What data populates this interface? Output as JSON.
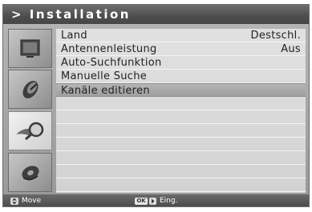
{
  "title": "> Installation",
  "menu": [
    {
      "label": "Land",
      "value": "Destschl.",
      "selected": false
    },
    {
      "label": "Antennenleistung",
      "value": "Aus",
      "selected": false
    },
    {
      "label": "Auto-Suchfunktion",
      "value": "",
      "selected": false
    },
    {
      "label": "Manuelle Suche",
      "value": "",
      "selected": false
    },
    {
      "label": "Kanäle editieren",
      "value": "",
      "selected": true
    }
  ],
  "side_icons": [
    {
      "name": "tv-screen-icon",
      "active": false
    },
    {
      "name": "satellite-dish-icon",
      "active": false
    },
    {
      "name": "search-magnifier-icon",
      "active": true
    },
    {
      "name": "disc-icon",
      "active": false
    }
  ],
  "footer": {
    "move_icon": "up-down-icon",
    "move_label": "Move",
    "ok_key": "OK",
    "ok_arrow_icon": "right-arrow-icon",
    "ok_label": "Eing."
  },
  "colors": {
    "title_bar": "#555555",
    "background": "#a7a7a7",
    "panel": "#d9d9d9",
    "selected_row": "#a9a9a9",
    "footer": "#555555"
  }
}
